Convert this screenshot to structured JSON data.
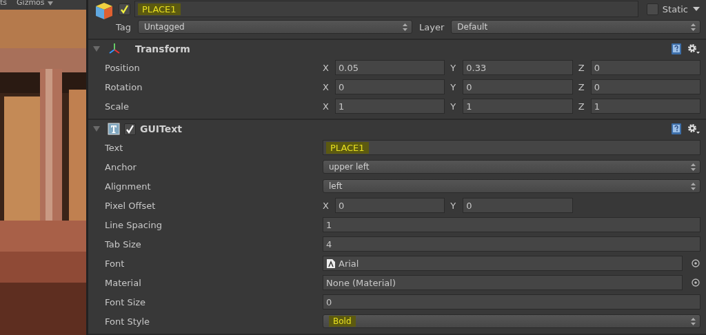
{
  "scene_toolbar": {
    "items": [
      {
        "label": "ts",
        "dropdown": false
      },
      {
        "label": "Gizmos",
        "dropdown": true
      }
    ]
  },
  "object": {
    "active": true,
    "name": "PLACE1",
    "name_highlighted": true,
    "static": false,
    "static_label": "Static",
    "tag_label": "Tag",
    "tag": "Untagged",
    "layer_label": "Layer",
    "layer": "Default"
  },
  "components": [
    {
      "kind": "transform",
      "title": "Transform",
      "expanded": true,
      "rows": [
        {
          "kind": "vector",
          "label": "Position",
          "values": [
            {
              "axis": "X",
              "value": "0.05"
            },
            {
              "axis": "Y",
              "value": "0.33"
            },
            {
              "axis": "Z",
              "value": "0"
            }
          ]
        },
        {
          "kind": "vector",
          "label": "Rotation",
          "values": [
            {
              "axis": "X",
              "value": "0"
            },
            {
              "axis": "Y",
              "value": "0"
            },
            {
              "axis": "Z",
              "value": "0"
            }
          ]
        },
        {
          "kind": "vector",
          "label": "Scale",
          "values": [
            {
              "axis": "X",
              "value": "1"
            },
            {
              "axis": "Y",
              "value": "1"
            },
            {
              "axis": "Z",
              "value": "1"
            }
          ]
        }
      ]
    },
    {
      "kind": "guitext",
      "title": "GUIText",
      "enabled": true,
      "expanded": true,
      "rows": [
        {
          "kind": "text",
          "label": "Text",
          "value": "PLACE1",
          "highlighted": true
        },
        {
          "kind": "dropdown",
          "label": "Anchor",
          "value": "upper left",
          "highlighted": false
        },
        {
          "kind": "dropdown",
          "label": "Alignment",
          "value": "left",
          "highlighted": false
        },
        {
          "kind": "vector",
          "label": "Pixel Offset",
          "values": [
            {
              "axis": "X",
              "value": "0"
            },
            {
              "axis": "Y",
              "value": "0"
            }
          ]
        },
        {
          "kind": "text",
          "label": "Line Spacing",
          "value": "1",
          "highlighted": false
        },
        {
          "kind": "text",
          "label": "Tab Size",
          "value": "4",
          "highlighted": false
        },
        {
          "kind": "asset",
          "label": "Font",
          "value": "Arial"
        },
        {
          "kind": "object",
          "label": "Material",
          "value": "None (Material)"
        },
        {
          "kind": "text",
          "label": "Font Size",
          "value": "0",
          "highlighted": false
        },
        {
          "kind": "dropdown",
          "label": "Font Style",
          "value": "Bold",
          "highlighted": true
        }
      ]
    }
  ]
}
